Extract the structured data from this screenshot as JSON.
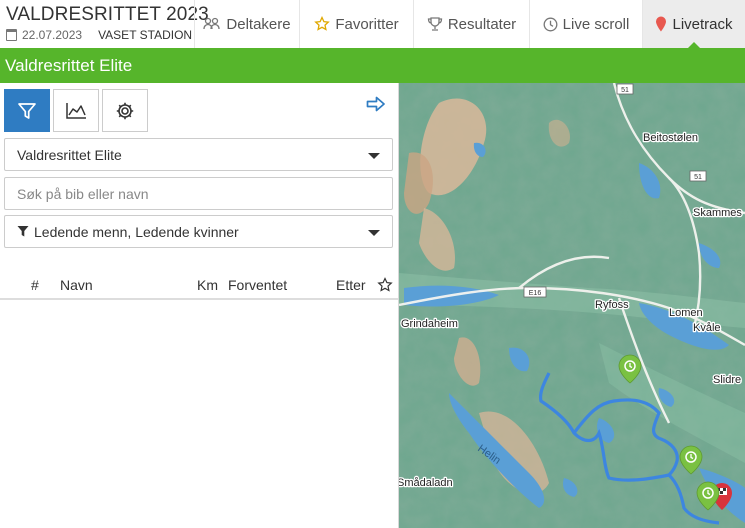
{
  "header": {
    "title": "VALDRESRITTET 2023",
    "date": "22.07.2023",
    "venue": "VASET STADION"
  },
  "nav": [
    {
      "label": "Deltakere",
      "icon": "people-icon"
    },
    {
      "label": "Favoritter",
      "icon": "star-icon"
    },
    {
      "label": "Resultater",
      "icon": "trophy-icon"
    },
    {
      "label": "Live scroll",
      "icon": "clock-icon"
    },
    {
      "label": "Livetrack",
      "icon": "map-pin-icon",
      "active": true
    }
  ],
  "race_bar": "Valdresrittet Elite",
  "panel": {
    "race_select": "Valdresrittet Elite",
    "search_placeholder": "Søk på bib eller navn",
    "filter_select": "Ledende menn, Ledende kvinner",
    "columns": {
      "num": "#",
      "name": "Navn",
      "km": "Km",
      "expected": "Forventet",
      "behind": "Etter"
    }
  },
  "map": {
    "labels": {
      "road_51_top": "51",
      "road_51": "51",
      "road_e16": "E16",
      "beitostolen": "Beitostølen",
      "skammes": "Skammes",
      "ryfoss": "Ryfoss",
      "lomen": "Lomen",
      "kvale": "Kvåle",
      "grindaheim": "Grindaheim",
      "slidre": "Slidre",
      "helin": "Helin",
      "smadaladn": "Smådaladn"
    }
  },
  "colors": {
    "green": "#56b52b",
    "blue": "#2f7cc2",
    "route": "#3d86e0"
  }
}
